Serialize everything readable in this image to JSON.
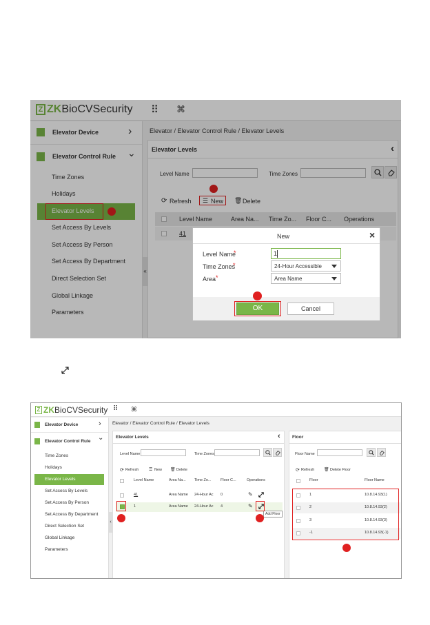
{
  "screen1": {
    "logo": {
      "mark": "Z",
      "zk": "ZK",
      "bio": "Bio",
      "cv": " CVSecurity"
    },
    "top_icons": {
      "apps": "⠿",
      "cmd": "⌘"
    },
    "breadcrumb": "Elevator / Elevator Control Rule / Elevator Levels",
    "panel_title": "Elevator Levels",
    "collapse": "‹",
    "sidebar": {
      "device": "Elevator Device",
      "control_rule": "Elevator Control Rule",
      "items": [
        "Time Zones",
        "Holidays",
        "Elevator Levels",
        "Set Access By Levels",
        "Set Access By Person",
        "Set Access By Department",
        "Direct Selection Set",
        "Global Linkage",
        "Parameters"
      ],
      "chev_right": "›",
      "chev_down": "⌄",
      "collapse_handle": "«"
    },
    "search": {
      "level_name_label": "Level Name",
      "time_zones_label": "Time Zones"
    },
    "toolbar": {
      "refresh": "Refresh",
      "new": "New",
      "delete": "Delete"
    },
    "table": {
      "headers": [
        "Level Name",
        "Area Na...",
        "Time Zo...",
        "Floor C...",
        "Operations"
      ],
      "row1": "41"
    },
    "dialog": {
      "title": "New",
      "close": "×",
      "level_name_label": "Level Name",
      "time_zones_label": "Time Zones",
      "area_label": "Area",
      "required": "*",
      "level_name_value": "1",
      "time_zones_value": "24-Hour Accessible",
      "area_value": "Area Name",
      "ok": "OK",
      "cancel": "Cancel"
    }
  },
  "screen2": {
    "logo": {
      "mark": "Z",
      "zk": "ZK",
      "bio": "Bio",
      "cv": " CVSecurity"
    },
    "top_icons": {
      "apps": "⠿",
      "cmd": "⌘"
    },
    "breadcrumb": "Elevator / Elevator Control Rule / Elevator Levels",
    "sidebar": {
      "device": "Elevator Device",
      "control_rule": "Elevator Control Rule",
      "items": [
        "Time Zones",
        "Holidays",
        "Elevator Levels",
        "Set Access By Levels",
        "Set Access By Person",
        "Set Access By Department",
        "Direct Selection Set",
        "Global Linkage",
        "Parameters"
      ],
      "chev_right": "›",
      "chev_down": "⌄",
      "collapse_handle": "‹"
    },
    "levels": {
      "title": "Elevator Levels",
      "collapse": "‹",
      "level_name_label": "Level Name",
      "time_zones_label": "Time Zones",
      "refresh": "Refresh",
      "new": "New",
      "delete": "Delete",
      "headers": [
        "Level Name",
        "Area Na...",
        "Time Zo...",
        "Floor C...",
        "Operations"
      ],
      "rows": [
        {
          "name": "41",
          "area": "Area Name",
          "tz": "24-Hour Ac",
          "floors": "0"
        },
        {
          "name": "1",
          "area": "Area Name",
          "tz": "24-Hour Ac",
          "floors": "4"
        }
      ],
      "tooltip": "Add Floor"
    },
    "floor": {
      "title": "Floor",
      "floor_name_label": "Floor Name",
      "refresh": "Refresh",
      "delete_floor": "Delete Floor",
      "headers": [
        "Floor",
        "Floor Name"
      ],
      "rows": [
        {
          "floor": "1",
          "name": "10.8.14.93(1)"
        },
        {
          "floor": "2",
          "name": "10.8.14.93(2)"
        },
        {
          "floor": "3",
          "name": "10.8.14.93(3)"
        },
        {
          "floor": "-1",
          "name": "10.8.14.93(-1)"
        }
      ]
    }
  }
}
